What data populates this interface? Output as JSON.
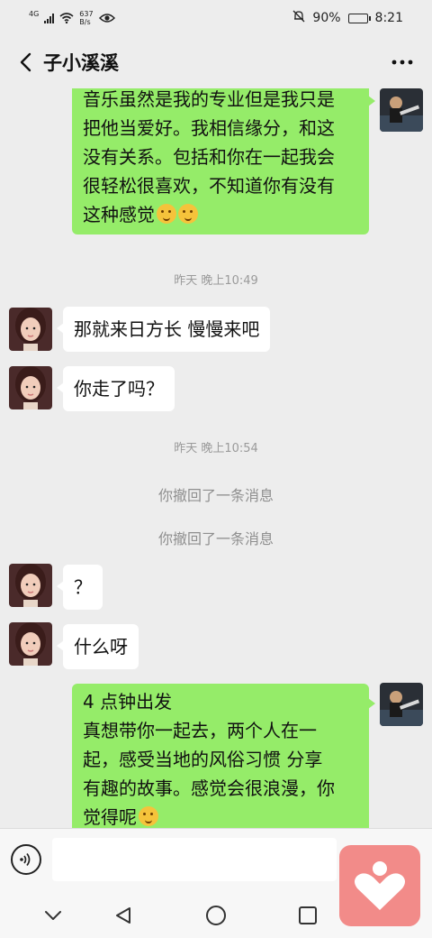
{
  "status_bar": {
    "network_label": "4G",
    "speed_value": "637",
    "speed_unit": "B/s",
    "battery": "90%",
    "battery_level": 0.9,
    "time": "8:21",
    "icons": [
      "signal-icon",
      "wifi-icon",
      "eye-icon",
      "mute-bell-icon",
      "battery-icon"
    ]
  },
  "header": {
    "title": "子小溪溪",
    "back_icon": "chevron-left-icon",
    "more_icon": "more-dots-icon"
  },
  "messages": [
    {
      "type": "sent",
      "lines": [
        "音乐虽然是我的专业但是我只是",
        "把他当爱好。我相信缘分，和这",
        "没有关系。包括和你在一起我会",
        "很轻松很喜欢，不知道你有没有",
        "这种感觉"
      ],
      "emoji_count": 2
    },
    {
      "type": "time",
      "text": "昨天 晚上10:49"
    },
    {
      "type": "recv",
      "text": "那就来日方长 慢慢来吧"
    },
    {
      "type": "recv",
      "text": "你走了吗？"
    },
    {
      "type": "time",
      "text": "昨天 晚上10:54"
    },
    {
      "type": "recall",
      "text": "你撤回了一条消息"
    },
    {
      "type": "recall",
      "text": "你撤回了一条消息"
    },
    {
      "type": "recv",
      "text": "？"
    },
    {
      "type": "recv",
      "text": "什么呀"
    },
    {
      "type": "sent",
      "lines": [
        "4 点钟出发",
        "真想带你一起去，两个人在一",
        "起，感受当地的风俗习惯 分享",
        "有趣的故事。感觉会很浪漫，你",
        "觉得呢"
      ],
      "emoji_count": 1
    }
  ],
  "input_bar": {
    "voice_icon": "voice-icon",
    "placeholder": "",
    "value": ""
  },
  "system_nav": {
    "icons": [
      "collapse-icon",
      "back-triangle-icon",
      "home-circle-icon",
      "recents-square-icon"
    ]
  },
  "floating_app": {
    "icon": "heart-person-icon",
    "color": "#f28b89"
  },
  "colors": {
    "sent_bubble": "#95ec69",
    "recv_bubble": "#ffffff",
    "background": "#ededed"
  }
}
